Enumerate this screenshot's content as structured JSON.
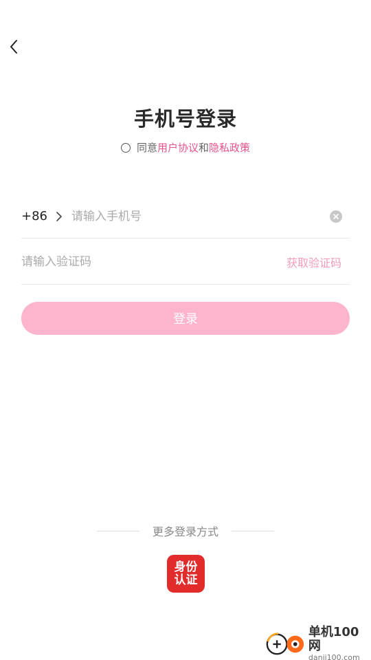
{
  "header": {
    "back_icon": "chevron-left-icon"
  },
  "title": "手机号登录",
  "agreement": {
    "prefix": "同意",
    "user_agreement": "用户协议",
    "conjunction": "和",
    "privacy_policy": "隐私政策",
    "link_color": "#e9548d"
  },
  "phone": {
    "country_code": "+86",
    "placeholder": "请输入手机号",
    "value": "",
    "clear_icon": "clear-circle-icon"
  },
  "verification": {
    "placeholder": "请输入验证码",
    "value": "",
    "get_code_label": "获取验证码"
  },
  "login": {
    "label": "登录",
    "color": "#fdb4cc"
  },
  "more_login": {
    "label": "更多登录方式",
    "id_auth_line1": "身份",
    "id_auth_line2": "认证",
    "id_auth_color": "#e22b2b"
  },
  "watermark": {
    "cn": "单机100网",
    "en": "danji100.com"
  }
}
